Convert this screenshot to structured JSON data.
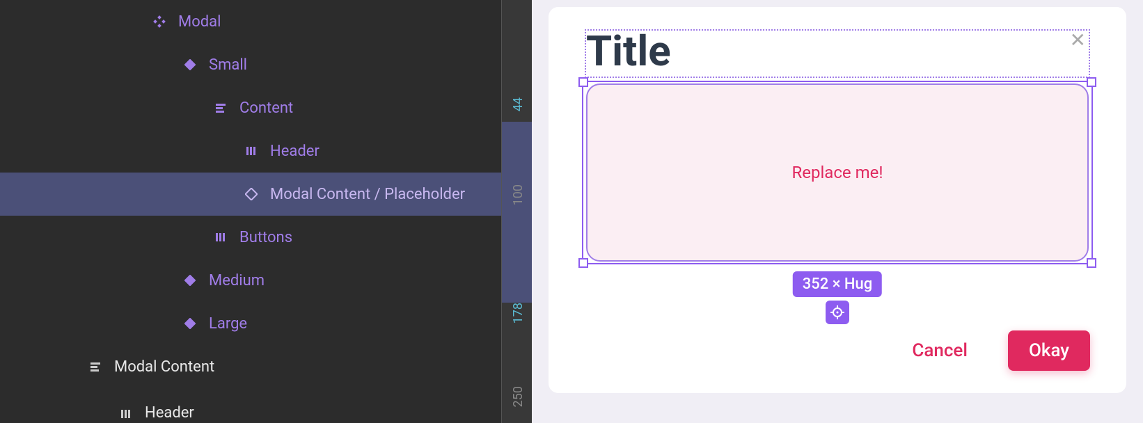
{
  "layers": {
    "modal": "Modal",
    "small": "Small",
    "content": "Content",
    "header": "Header",
    "placeholder": "Modal Content / Placeholder",
    "buttons": "Buttons",
    "medium": "Medium",
    "large": "Large",
    "modal_content": "Modal Content",
    "header2": "Header"
  },
  "ruler": {
    "n1": "44",
    "n2": "100",
    "n3": "178",
    "n4": "250"
  },
  "canvas": {
    "title": "Title",
    "placeholder_text": "Replace me!",
    "size_badge": "352 × Hug",
    "cancel": "Cancel",
    "okay": "Okay"
  }
}
